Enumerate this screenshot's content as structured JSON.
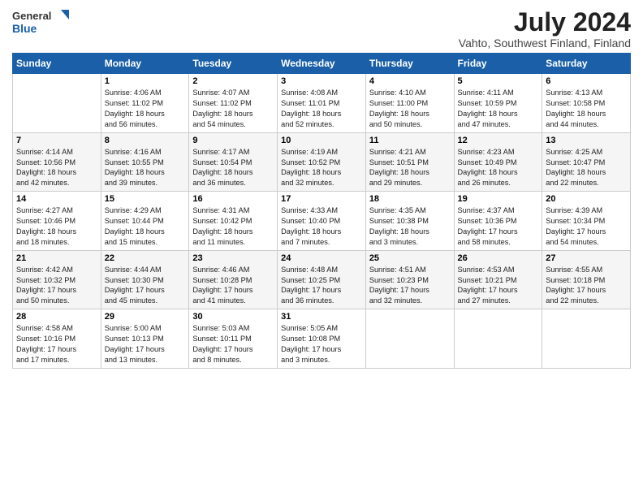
{
  "header": {
    "logo_line1": "General",
    "logo_line2": "Blue",
    "month_year": "July 2024",
    "location": "Vahto, Southwest Finland, Finland"
  },
  "days_of_week": [
    "Sunday",
    "Monday",
    "Tuesday",
    "Wednesday",
    "Thursday",
    "Friday",
    "Saturday"
  ],
  "weeks": [
    [
      {
        "day": "",
        "content": ""
      },
      {
        "day": "1",
        "content": "Sunrise: 4:06 AM\nSunset: 11:02 PM\nDaylight: 18 hours\nand 56 minutes."
      },
      {
        "day": "2",
        "content": "Sunrise: 4:07 AM\nSunset: 11:02 PM\nDaylight: 18 hours\nand 54 minutes."
      },
      {
        "day": "3",
        "content": "Sunrise: 4:08 AM\nSunset: 11:01 PM\nDaylight: 18 hours\nand 52 minutes."
      },
      {
        "day": "4",
        "content": "Sunrise: 4:10 AM\nSunset: 11:00 PM\nDaylight: 18 hours\nand 50 minutes."
      },
      {
        "day": "5",
        "content": "Sunrise: 4:11 AM\nSunset: 10:59 PM\nDaylight: 18 hours\nand 47 minutes."
      },
      {
        "day": "6",
        "content": "Sunrise: 4:13 AM\nSunset: 10:58 PM\nDaylight: 18 hours\nand 44 minutes."
      }
    ],
    [
      {
        "day": "7",
        "content": "Sunrise: 4:14 AM\nSunset: 10:56 PM\nDaylight: 18 hours\nand 42 minutes."
      },
      {
        "day": "8",
        "content": "Sunrise: 4:16 AM\nSunset: 10:55 PM\nDaylight: 18 hours\nand 39 minutes."
      },
      {
        "day": "9",
        "content": "Sunrise: 4:17 AM\nSunset: 10:54 PM\nDaylight: 18 hours\nand 36 minutes."
      },
      {
        "day": "10",
        "content": "Sunrise: 4:19 AM\nSunset: 10:52 PM\nDaylight: 18 hours\nand 32 minutes."
      },
      {
        "day": "11",
        "content": "Sunrise: 4:21 AM\nSunset: 10:51 PM\nDaylight: 18 hours\nand 29 minutes."
      },
      {
        "day": "12",
        "content": "Sunrise: 4:23 AM\nSunset: 10:49 PM\nDaylight: 18 hours\nand 26 minutes."
      },
      {
        "day": "13",
        "content": "Sunrise: 4:25 AM\nSunset: 10:47 PM\nDaylight: 18 hours\nand 22 minutes."
      }
    ],
    [
      {
        "day": "14",
        "content": "Sunrise: 4:27 AM\nSunset: 10:46 PM\nDaylight: 18 hours\nand 18 minutes."
      },
      {
        "day": "15",
        "content": "Sunrise: 4:29 AM\nSunset: 10:44 PM\nDaylight: 18 hours\nand 15 minutes."
      },
      {
        "day": "16",
        "content": "Sunrise: 4:31 AM\nSunset: 10:42 PM\nDaylight: 18 hours\nand 11 minutes."
      },
      {
        "day": "17",
        "content": "Sunrise: 4:33 AM\nSunset: 10:40 PM\nDaylight: 18 hours\nand 7 minutes."
      },
      {
        "day": "18",
        "content": "Sunrise: 4:35 AM\nSunset: 10:38 PM\nDaylight: 18 hours\nand 3 minutes."
      },
      {
        "day": "19",
        "content": "Sunrise: 4:37 AM\nSunset: 10:36 PM\nDaylight: 17 hours\nand 58 minutes."
      },
      {
        "day": "20",
        "content": "Sunrise: 4:39 AM\nSunset: 10:34 PM\nDaylight: 17 hours\nand 54 minutes."
      }
    ],
    [
      {
        "day": "21",
        "content": "Sunrise: 4:42 AM\nSunset: 10:32 PM\nDaylight: 17 hours\nand 50 minutes."
      },
      {
        "day": "22",
        "content": "Sunrise: 4:44 AM\nSunset: 10:30 PM\nDaylight: 17 hours\nand 45 minutes."
      },
      {
        "day": "23",
        "content": "Sunrise: 4:46 AM\nSunset: 10:28 PM\nDaylight: 17 hours\nand 41 minutes."
      },
      {
        "day": "24",
        "content": "Sunrise: 4:48 AM\nSunset: 10:25 PM\nDaylight: 17 hours\nand 36 minutes."
      },
      {
        "day": "25",
        "content": "Sunrise: 4:51 AM\nSunset: 10:23 PM\nDaylight: 17 hours\nand 32 minutes."
      },
      {
        "day": "26",
        "content": "Sunrise: 4:53 AM\nSunset: 10:21 PM\nDaylight: 17 hours\nand 27 minutes."
      },
      {
        "day": "27",
        "content": "Sunrise: 4:55 AM\nSunset: 10:18 PM\nDaylight: 17 hours\nand 22 minutes."
      }
    ],
    [
      {
        "day": "28",
        "content": "Sunrise: 4:58 AM\nSunset: 10:16 PM\nDaylight: 17 hours\nand 17 minutes."
      },
      {
        "day": "29",
        "content": "Sunrise: 5:00 AM\nSunset: 10:13 PM\nDaylight: 17 hours\nand 13 minutes."
      },
      {
        "day": "30",
        "content": "Sunrise: 5:03 AM\nSunset: 10:11 PM\nDaylight: 17 hours\nand 8 minutes."
      },
      {
        "day": "31",
        "content": "Sunrise: 5:05 AM\nSunset: 10:08 PM\nDaylight: 17 hours\nand 3 minutes."
      },
      {
        "day": "",
        "content": ""
      },
      {
        "day": "",
        "content": ""
      },
      {
        "day": "",
        "content": ""
      }
    ]
  ]
}
